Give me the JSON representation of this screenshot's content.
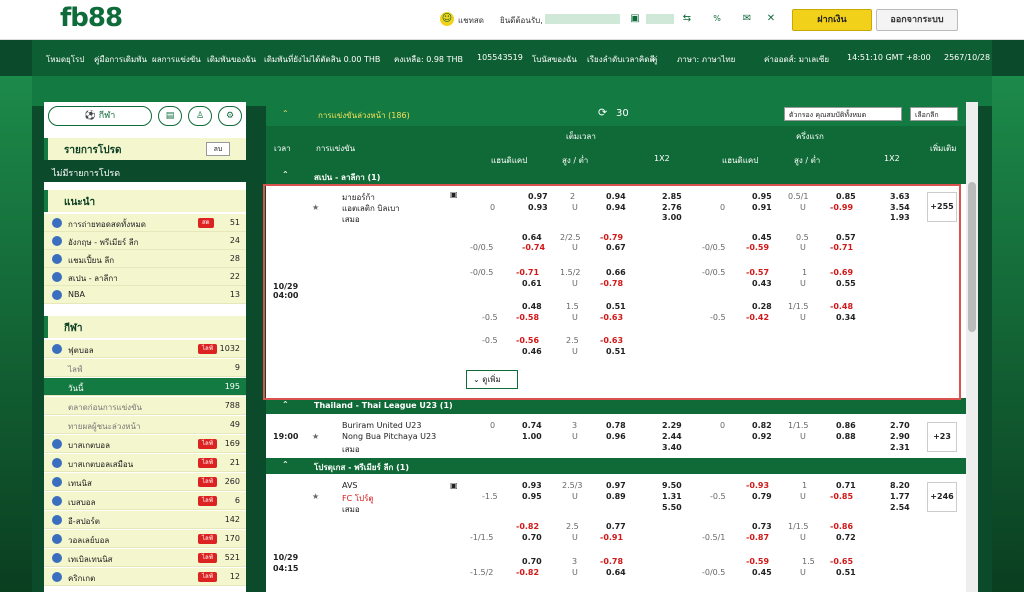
{
  "logo": {
    "main": "fb88",
    ".com": ".com"
  },
  "top": {
    "chat": "แชทสด",
    "welcome": "ยินดีต้อนรับ,",
    "deposit": "ฝากเงิน",
    "logout": "ออกจากระบบ"
  },
  "nav": [
    "โหมดยุโรป",
    "คู่มือการเดิมพัน",
    "ผลการแข่งขัน",
    "เดิมพันของฉัน",
    "เดิมพันที่ยังไม่ได้ตัดสิน 0.00 THB",
    "คงเหลือ: 0.98 THB",
    "105543519",
    "โบนัสของฉัน",
    "เรียงลำดับเวลาคิดดี",
    "คู่",
    "ภาษา: ภาษาไทย",
    "ค่าออดส์: มาเลเซีย",
    "14:51:10 GMT +8:00",
    "2567/10/28"
  ],
  "sidebar": {
    "tabs": [
      "กีฬา"
    ],
    "list_title": "รายการโปรด",
    "list_btn": "ลบ",
    "empty": "ไม่มีรายการโปรด",
    "rec_title": "แนะนำ",
    "rec": [
      {
        "label": "การถ่ายทอดสดทั้งหมด",
        "count": "51",
        "badge": "สด"
      },
      {
        "label": "อังกฤษ - พรีเมียร์ ลีก",
        "count": "24"
      },
      {
        "label": "แชมเปี้ยน ลีก",
        "count": "28"
      },
      {
        "label": "สเปน - ลาลีกา",
        "count": "22"
      },
      {
        "label": "NBA",
        "count": "13"
      }
    ],
    "sport_title": "กีฬา",
    "sports": [
      {
        "label": "ฟุตบอล",
        "count": "1032",
        "badge": "ไลฟ์"
      },
      {
        "label": "ไลฟ์",
        "count": "9",
        "sub": true
      },
      {
        "label": "วันนี้",
        "count": "195",
        "sub": true,
        "sel": true
      },
      {
        "label": "ตลาดก่อนการแข่งขัน",
        "count": "788",
        "sub": true
      },
      {
        "label": "ทายผลผู้ชนะล่วงหน้า",
        "count": "49",
        "sub": true
      },
      {
        "label": "บาสเกตบอล",
        "count": "169",
        "badge": "ไลฟ์"
      },
      {
        "label": "บาสเกตบอลเสมือน",
        "count": "21",
        "badge": "ไลฟ์"
      },
      {
        "label": "เทนนิส",
        "count": "260",
        "badge": "ไลฟ์"
      },
      {
        "label": "เบสบอล",
        "count": "6",
        "badge": "ไลฟ์"
      },
      {
        "label": "อี-สปอร์ต",
        "count": "142"
      },
      {
        "label": "วอลเลย์บอล",
        "count": "170",
        "badge": "ไลฟ์"
      },
      {
        "label": "เทเบิลเทนนิส",
        "count": "521",
        "badge": "ไลฟ์"
      },
      {
        "label": "คริกเกต",
        "count": "12",
        "badge": "ไลฟ์"
      }
    ]
  },
  "main": {
    "header": "การแข่งขันล่วงหน้า (186)",
    "refresh": "30",
    "filter": "ตัวกรอง คุณสมบัติทั้งหมด",
    "choose": "เลือกลีก",
    "cols": {
      "time": "เวลา",
      "match": "การแข่งขัน",
      "ft": "เต็มเวลา",
      "ht": "ครึ่งแรก",
      "hdp": "แฮนดิแคป",
      "ou": "สูง / ต่ำ",
      "x12": "1X2",
      "more": "เพิ่มเติม"
    },
    "leagues": [
      "สเปน - ลาลีกา (1)",
      "Thailand - Thai League U23 (1)",
      "โปรตุเกส - พรีเมียร์ ลีก (1)"
    ],
    "m1": {
      "date": "10/29",
      "time": "04:00",
      "home": "มายอร์ก้า",
      "away": "แอตเลติก บิลเบา",
      "draw": "เสมอ",
      "more": "+255",
      "expand": "ดูเพิ่ม"
    },
    "m2": {
      "time": "19:00",
      "home": "Buriram United U23",
      "away": "Nong Bua Pitchaya U23",
      "draw": "เสมอ",
      "more": "+23"
    },
    "m3": {
      "date": "10/29",
      "time": "04:15",
      "home": "AVS",
      "away": "FC โปร์ตู",
      "draw": "เสมอ",
      "more": "+246"
    }
  }
}
